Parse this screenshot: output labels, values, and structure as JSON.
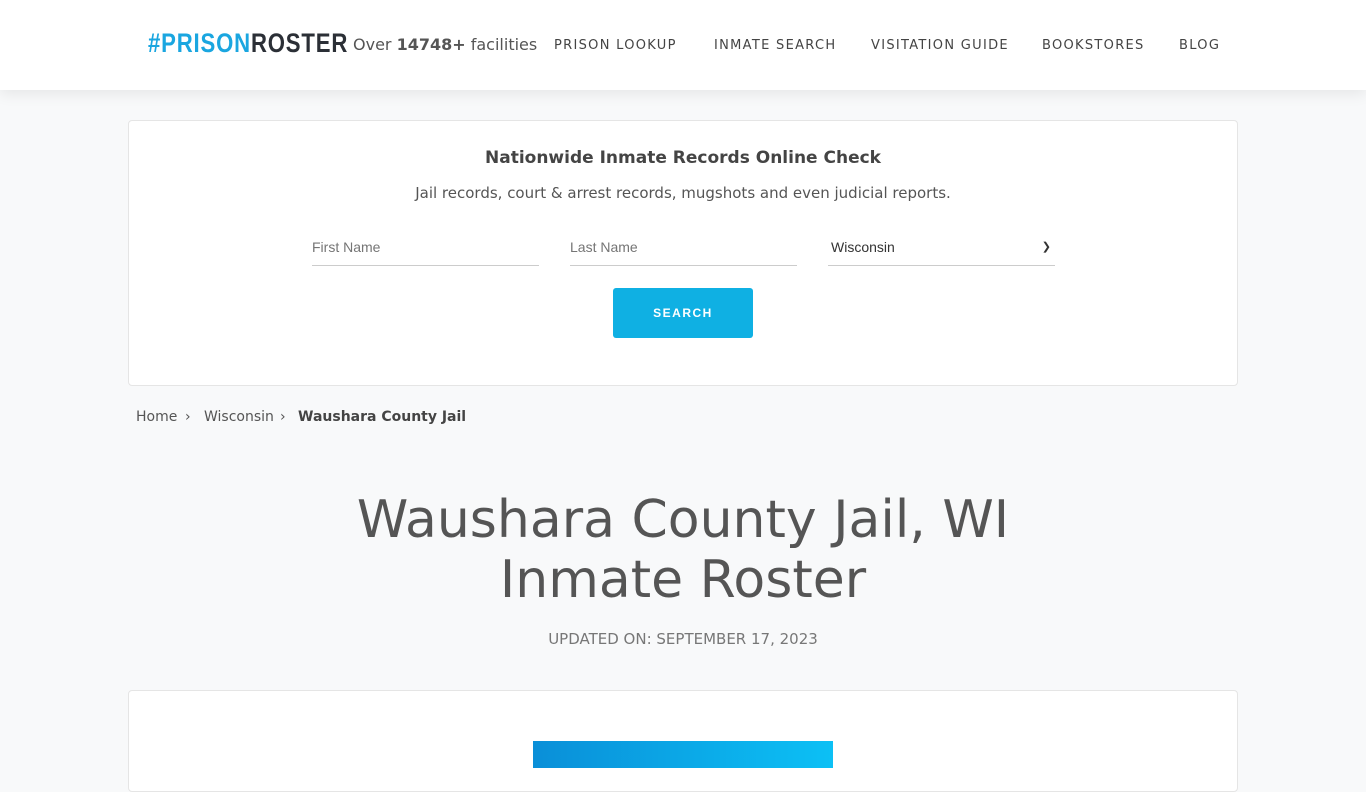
{
  "header": {
    "logo_hash": "#PRISON",
    "logo_rest": "ROSTER",
    "count_prefix": "Over ",
    "count": "14748+",
    "count_suffix": " facilities",
    "nav": [
      "PRISON LOOKUP",
      "INMATE SEARCH",
      "VISITATION GUIDE",
      "BOOKSTORES",
      "BLOG"
    ]
  },
  "search": {
    "title": "Nationwide Inmate Records Online Check",
    "subtitle": "Jail records, court & arrest records, mugshots and even judicial reports.",
    "first_placeholder": "First Name",
    "last_placeholder": "Last Name",
    "state": "Wisconsin",
    "button": "SEARCH"
  },
  "breadcrumb": [
    "Home",
    "Wisconsin",
    "Waushara County Jail"
  ],
  "page": {
    "title": "Waushara County Jail, WI Inmate Roster",
    "updated": "UPDATED ON: SEPTEMBER 17, 2023"
  },
  "colors": {
    "accent": "#0fb0e3"
  }
}
